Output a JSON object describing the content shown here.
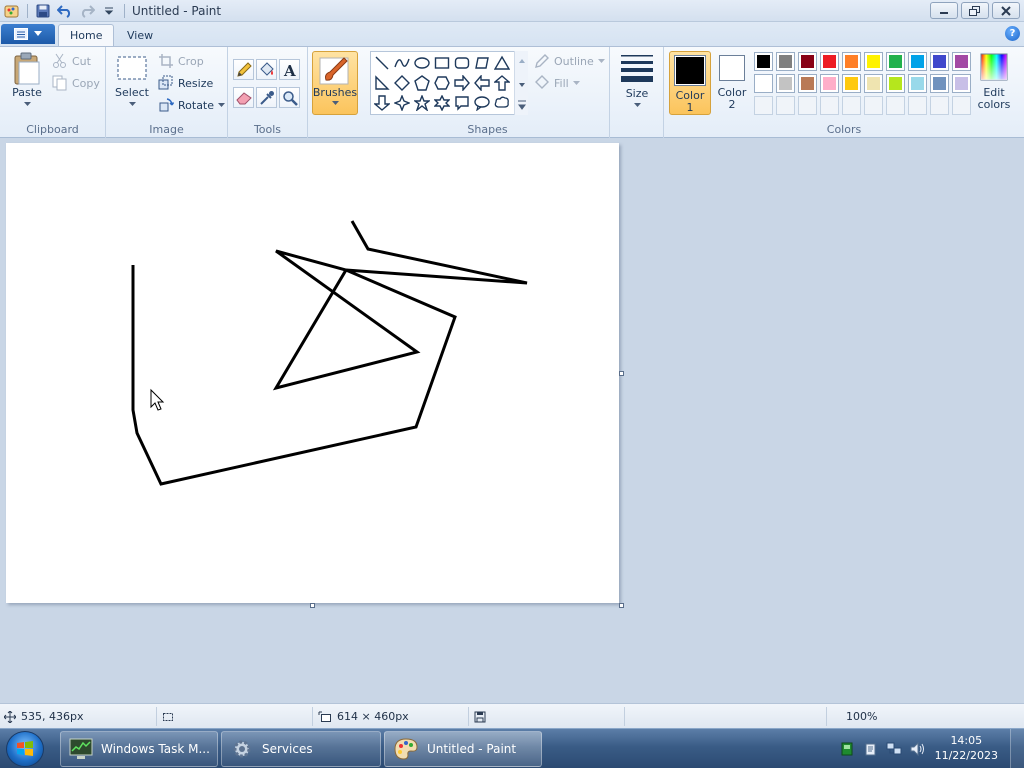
{
  "window": {
    "title": "Untitled - Paint"
  },
  "tabs": {
    "home": "Home",
    "view": "View"
  },
  "clipboard": {
    "paste": "Paste",
    "cut": "Cut",
    "copy": "Copy",
    "group_label": "Clipboard"
  },
  "image": {
    "select": "Select",
    "crop": "Crop",
    "resize": "Resize",
    "rotate": "Rotate",
    "group_label": "Image"
  },
  "tools": {
    "group_label": "Tools"
  },
  "brushes": {
    "label": "Brushes"
  },
  "shapes": {
    "outline": "Outline",
    "fill": "Fill",
    "group_label": "Shapes"
  },
  "size": {
    "label": "Size"
  },
  "colors": {
    "color1_line1": "Color",
    "color1_line2": "1",
    "color2_line1": "Color",
    "color2_line2": "2",
    "edit_line1": "Edit",
    "edit_line2": "colors",
    "group_label": "Colors",
    "color1_value": "#000000",
    "color2_value": "#ffffff",
    "palette_row1": [
      "#000000",
      "#7f7f7f",
      "#880015",
      "#ed1c24",
      "#ff7f27",
      "#fff200",
      "#22b14c",
      "#00a2e8",
      "#3f48cc",
      "#a349a4"
    ],
    "palette_row2": [
      "#ffffff",
      "#c3c3c3",
      "#b97a57",
      "#ffaec9",
      "#ffc90e",
      "#efe4b0",
      "#b5e61d",
      "#99d9ea",
      "#7092be",
      "#c8bfe7"
    ]
  },
  "statusbar": {
    "cursor_position": "535, 436px",
    "canvas_size": "614 × 460px",
    "zoom": "100%"
  },
  "taskbar": {
    "items": [
      "Windows Task M...",
      "Services",
      "Untitled - Paint"
    ],
    "time": "14:05",
    "date": "11/22/2023"
  }
}
